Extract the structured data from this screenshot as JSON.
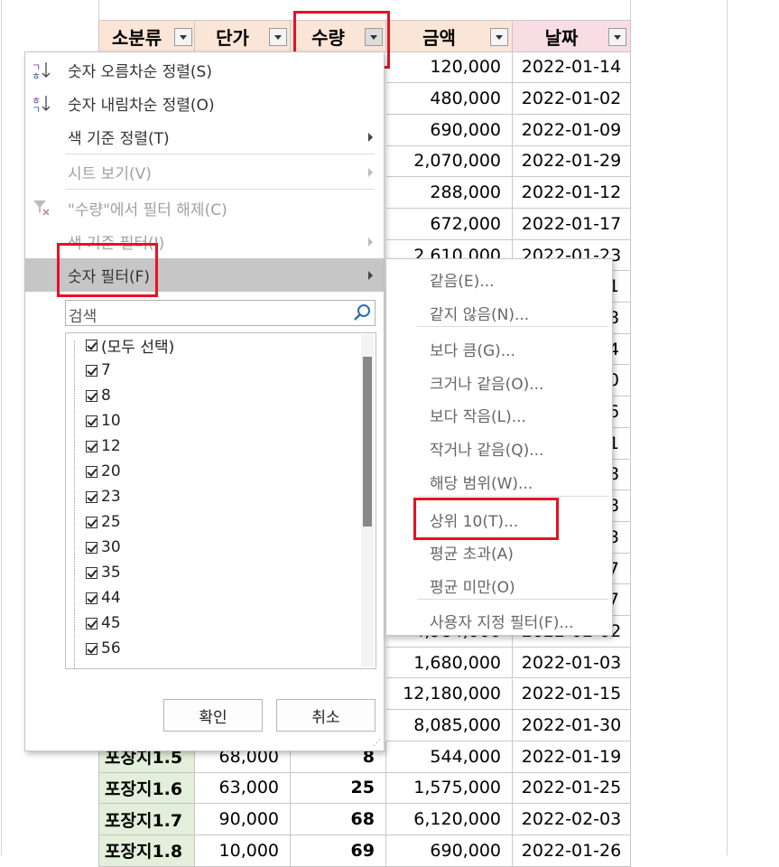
{
  "sheet": {
    "headers": [
      "소분류",
      "단가",
      "수량",
      "금액",
      "날짜"
    ],
    "amounts": [
      "120,000",
      "480,000",
      "690,000",
      "2,070,000",
      "288,000",
      "672,000",
      "2,610,000",
      "",
      "",
      "",
      "",
      "",
      "",
      "",
      "",
      "",
      "",
      "",
      "4,984,000",
      "1,680,000",
      "12,180,000",
      "8,085,000",
      "544,000",
      "1,575,000",
      "6,120,000",
      "690,000"
    ],
    "dates": [
      "2022-01-14",
      "2022-01-02",
      "2022-01-09",
      "2022-01-29",
      "2022-01-12",
      "2022-01-17",
      "2022-01-23",
      "1",
      "8",
      "4",
      "0",
      "6",
      "1",
      "8",
      "8",
      "3",
      "7",
      "7",
      "2022-02-02",
      "2022-01-03",
      "2022-01-15",
      "2022-01-30",
      "2022-01-19",
      "2022-01-25",
      "2022-02-03",
      "2022-01-26"
    ],
    "bottom_rows": [
      {
        "cat": "포장지1.5",
        "price": "68,000",
        "qty": "8"
      },
      {
        "cat": "포장지1.6",
        "price": "63,000",
        "qty": "25"
      },
      {
        "cat": "포장지1.7",
        "price": "90,000",
        "qty": "68"
      },
      {
        "cat": "포장지1.8",
        "price": "10,000",
        "qty": "69"
      }
    ]
  },
  "menu": {
    "sort_asc": "숫자 오름차순 정렬(S)",
    "sort_desc": "숫자 내림차순 정렬(O)",
    "sort_color": "색 기준 정렬(T)",
    "sheet_view": "시트 보기(V)",
    "clear_filter": "\"수량\"에서 필터 해제(C)",
    "color_filter": "색 기준 필터(I)",
    "number_filter": "숫자 필터(F)",
    "search_placeholder": "검색",
    "items": [
      "(모두 선택)",
      "7",
      "8",
      "10",
      "12",
      "20",
      "23",
      "25",
      "30",
      "35",
      "44",
      "45",
      "56"
    ],
    "ok": "확인",
    "cancel": "취소"
  },
  "submenu": {
    "items": [
      "같음(E)...",
      "같지 않음(N)...",
      "보다 큼(G)...",
      "크거나 같음(O)...",
      "보다 작음(L)...",
      "작거나 같음(Q)...",
      "해당 범위(W)...",
      "상위 10(T)...",
      "평균 초과(A)",
      "평균 미만(O)",
      "사용자 지정 필터(F)..."
    ]
  }
}
